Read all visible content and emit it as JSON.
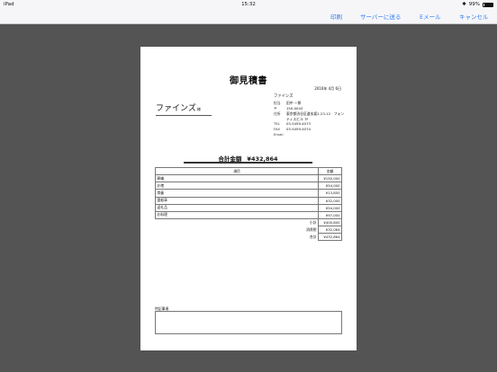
{
  "status_bar": {
    "device": "iPad",
    "time": "15:32",
    "battery": "99%"
  },
  "toolbar": {
    "print": "印刷",
    "send_to_server": "サーバーに送る",
    "email": "Eメール",
    "cancel": "キャンセル"
  },
  "document": {
    "title": "御見積書",
    "date": "2016年 4月 6日",
    "client_name": "ファインズ",
    "client_suffix": "様",
    "issuer": {
      "company": "ファインズ",
      "fields": [
        {
          "label": "担当",
          "value": "田中 一郎"
        },
        {
          "label": "〒",
          "value": "150-0043"
        },
        {
          "label": "住所",
          "value": "東京都渋谷区道玄坂2-23-12　フォンティスビル 7F"
        },
        {
          "label": "TEL",
          "value": "03-5459-4073"
        },
        {
          "label": "FAX",
          "value": "03-5459-4074"
        },
        {
          "label": "Email",
          "value": ""
        }
      ]
    },
    "total_label": "合計金額",
    "total_value": "¥432,864",
    "table": {
      "headers": [
        "項目",
        "金額"
      ],
      "rows": [
        {
          "item": "葬儀",
          "amount": "¥150,000"
        },
        {
          "item": "お棺",
          "amount": "¥54,000"
        },
        {
          "item": "骨壷",
          "amount": "¥13,800"
        },
        {
          "item": "霊柩車",
          "amount": "¥32,000"
        },
        {
          "item": "返礼品",
          "amount": "¥54,000"
        },
        {
          "item": "お料理",
          "amount": "¥97,000"
        }
      ],
      "summary": [
        {
          "label": "小計",
          "amount": "¥400,800"
        },
        {
          "label": "消費税",
          "amount": "¥32,064"
        },
        {
          "label": "合計",
          "amount": "¥432,864"
        }
      ]
    },
    "notes_label": "特記事項",
    "notes_value": ""
  }
}
